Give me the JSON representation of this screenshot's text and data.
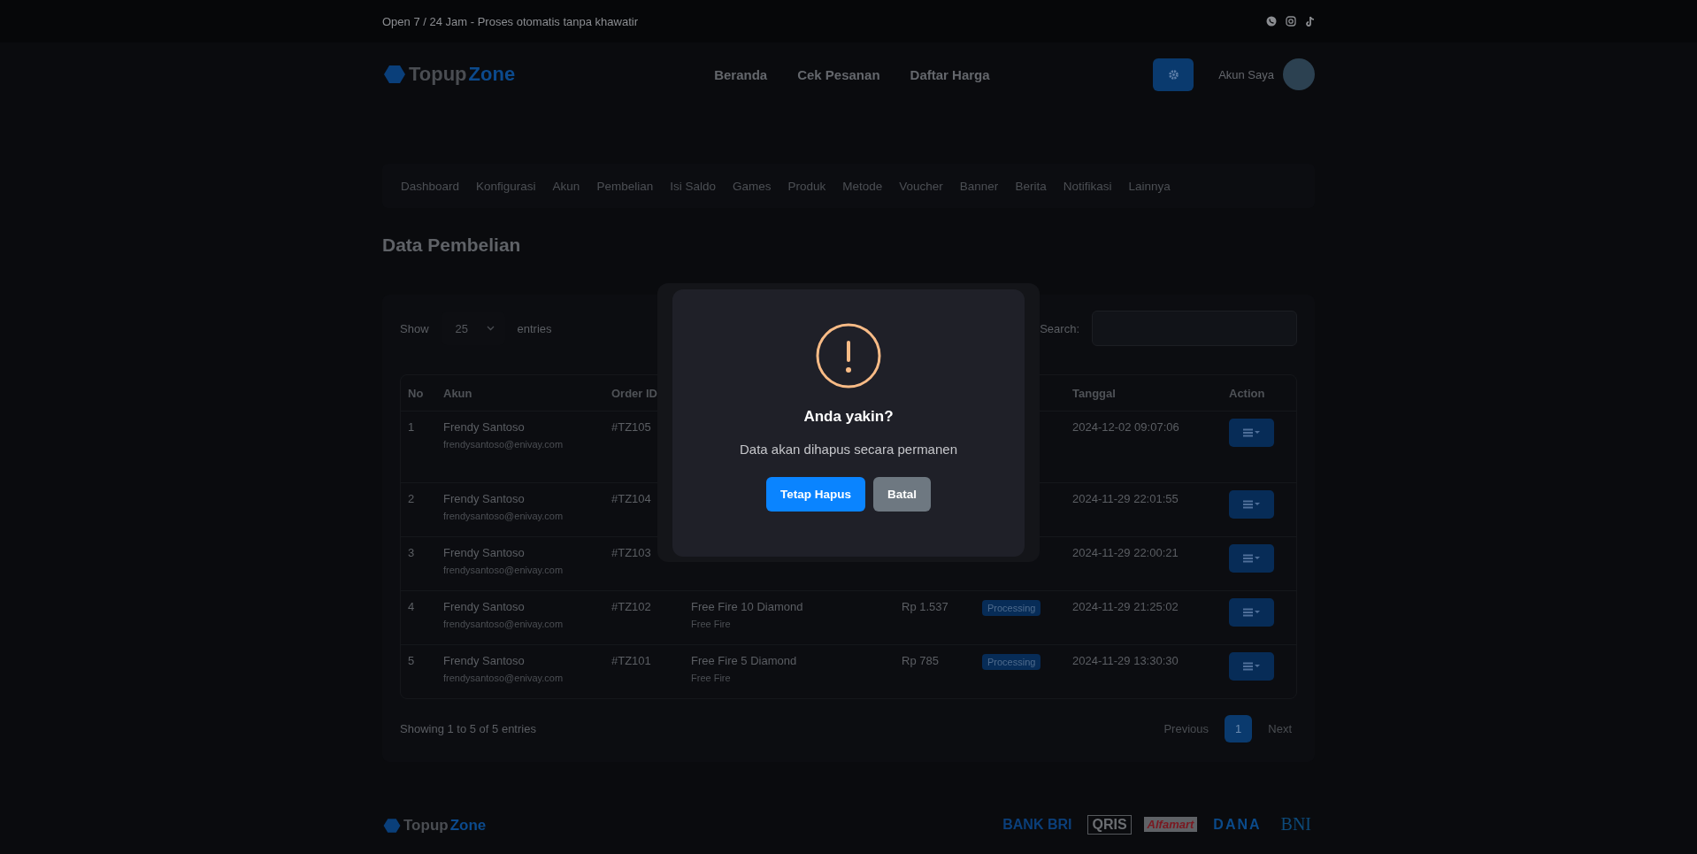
{
  "top_bar": {
    "text": "Open 7 / 24 Jam - Proses otomatis tanpa khawatir"
  },
  "header": {
    "logo": {
      "part_1": "Topup",
      "part_2": "Zone"
    },
    "nav": [
      "Beranda",
      "Cek Pesanan",
      "Daftar Harga"
    ],
    "account": "Akun Saya"
  },
  "admin_menu": [
    "Dashboard",
    "Konfigurasi",
    "Akun",
    "Pembelian",
    "Isi Saldo",
    "Games",
    "Produk",
    "Metode",
    "Voucher",
    "Banner",
    "Berita",
    "Notifikasi",
    "Lainnya"
  ],
  "page_title": "Data Pembelian",
  "table_controls": {
    "show_label": "Show",
    "page_size": "25",
    "entries_label": "entries",
    "search_label": "Search:"
  },
  "table": {
    "columns": [
      {
        "label": "No"
      },
      {
        "label": "Akun"
      },
      {
        "label": "Order ID"
      },
      {},
      {},
      {},
      {
        "label": "Tanggal"
      },
      {
        "label": "Action"
      }
    ],
    "rows": [
      {
        "no": "1",
        "name": "Frendy Santoso",
        "email": "frendysantoso@enivay.com",
        "order_id": "#TZ105",
        "date": "2024-12-02 09:07:06"
      },
      {
        "no": "2",
        "name": "Frendy Santoso",
        "email": "frendysantoso@enivay.com",
        "order_id": "#TZ104",
        "date": "2024-11-29 22:01:55"
      },
      {
        "no": "3",
        "name": "Frendy Santoso",
        "email": "frendysantoso@enivay.com",
        "order_id": "#TZ103",
        "date": "2024-11-29 22:00:21"
      },
      {
        "no": "4",
        "name": "Frendy Santoso",
        "email": "frendysantoso@enivay.com",
        "order_id": "#TZ102",
        "product": "Free Fire 10 Diamond",
        "game": "Free Fire",
        "price": "Rp 1.537",
        "status": {
          "label": "Processing",
          "kind": "processing"
        },
        "date": "2024-11-29 21:25:02"
      },
      {
        "no": "5",
        "name": "Frendy Santoso",
        "email": "frendysantoso@enivay.com",
        "order_id": "#TZ101",
        "product": "Free Fire 5 Diamond",
        "game": "Free Fire",
        "price": "Rp 785",
        "status": {
          "label": "Processing",
          "kind": "processing"
        },
        "date": "2024-11-29 13:30:30"
      }
    ]
  },
  "table_info": "Showing 1 to 5 of 5 entries",
  "pagination": [
    {
      "label": "Previous",
      "selected": false
    },
    {
      "label": "1",
      "selected": true
    },
    {
      "label": "Next",
      "selected": false
    }
  ],
  "modal": {
    "title": "Anda yakin?",
    "message": "Data akan dihapus secara permanen",
    "buttons": [
      {
        "label": "Tetap Hapus",
        "kind": "confirm"
      },
      {
        "label": "Batal",
        "kind": "cancel"
      }
    ]
  },
  "footer": {
    "logo": {
      "part_1": "Topup",
      "part_2": "Zone"
    },
    "payments": [
      "BANK BRI",
      "QRIS",
      "Alfamart",
      "DANA",
      "BNI"
    ]
  }
}
